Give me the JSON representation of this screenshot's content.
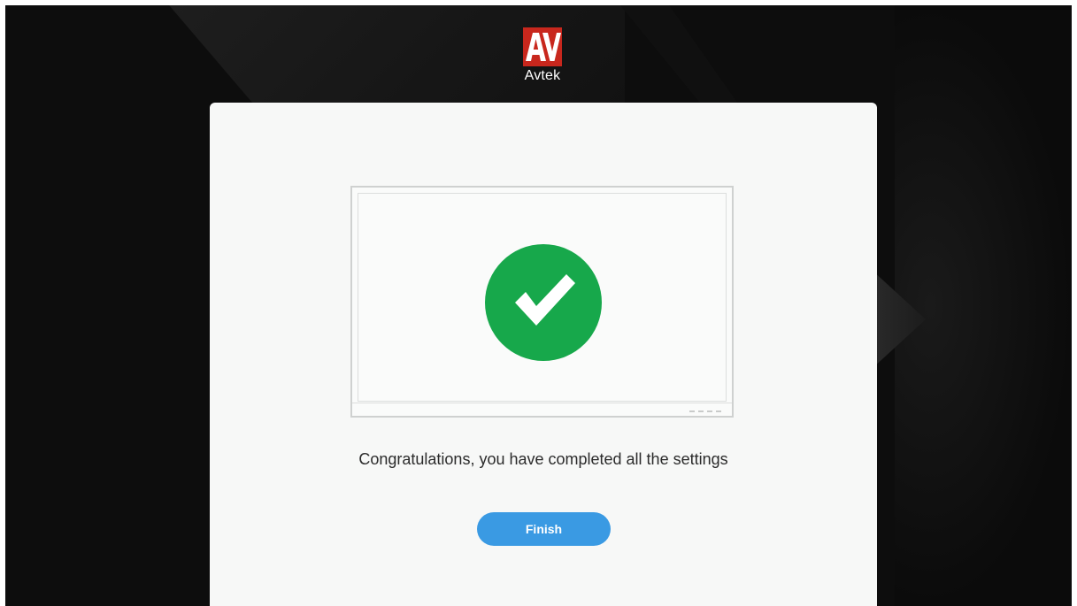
{
  "brand": {
    "name": "Avtek",
    "logo_letters": "AV",
    "logo_color": "#c8271d"
  },
  "main": {
    "illustration_icon": "check-circle-icon",
    "success_color": "#17a84b",
    "message": "Congratulations, you have completed all the settings",
    "finish_label": "Finish",
    "button_color": "#3a9ae3"
  }
}
